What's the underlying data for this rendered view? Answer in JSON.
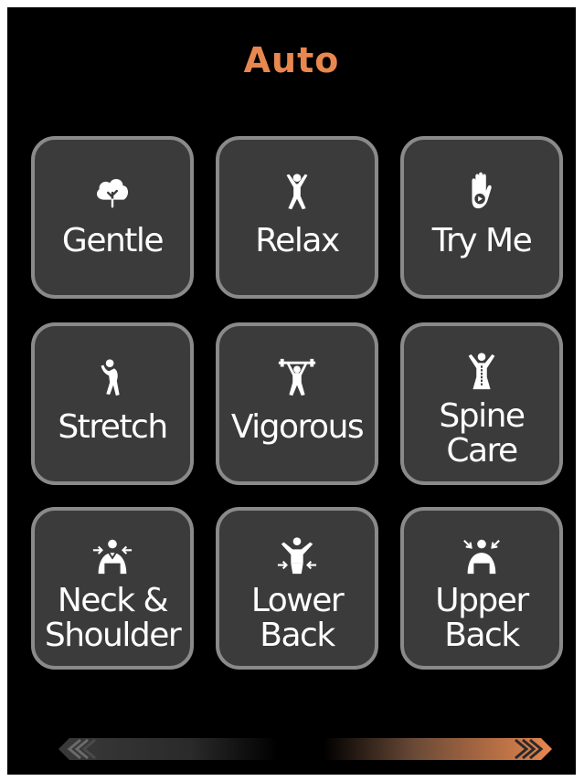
{
  "header": {
    "title": "Auto"
  },
  "programs": [
    {
      "label_line1": "Gentle",
      "label_line2": "",
      "icon": "cloud-leaf-icon"
    },
    {
      "label_line1": "Relax",
      "label_line2": "",
      "icon": "person-arms-up-icon"
    },
    {
      "label_line1": "Try Me",
      "label_line2": "",
      "icon": "hand-play-icon"
    },
    {
      "label_line1": "Stretch",
      "label_line2": "",
      "icon": "person-stretch-icon"
    },
    {
      "label_line1": "Vigorous",
      "label_line2": "",
      "icon": "weightlifter-icon"
    },
    {
      "label_line1": "Spine",
      "label_line2": "Care",
      "icon": "spine-person-icon"
    },
    {
      "label_line1": "Neck &",
      "label_line2": "Shoulder",
      "icon": "neck-shoulder-icon"
    },
    {
      "label_line1": "Lower",
      "label_line2": "Back",
      "icon": "lower-back-icon"
    },
    {
      "label_line1": "Upper",
      "label_line2": "Back",
      "icon": "upper-back-icon"
    }
  ],
  "pager": {
    "left_icon": "double-chevron-left-icon",
    "right_icon": "double-chevron-right-icon"
  },
  "colors": {
    "accent": "#e8874f",
    "tile_bg": "#3b3b3b",
    "tile_border": "#8a8a8a",
    "background": "#000000"
  }
}
